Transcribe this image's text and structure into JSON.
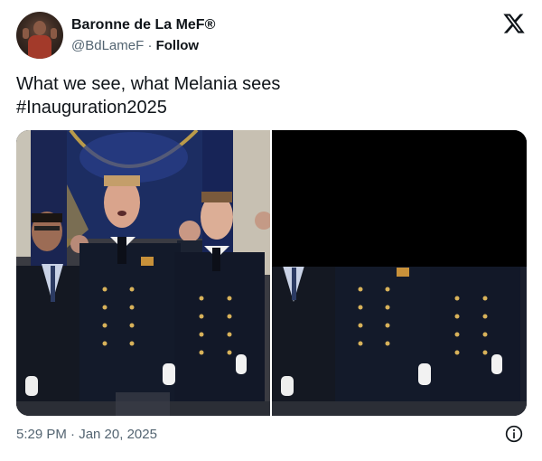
{
  "author": {
    "display_name": "Baronne de La MeF®",
    "handle": "@BdLameF",
    "separator": "·",
    "follow_label": "Follow"
  },
  "tweet": {
    "line1": "What we see, what Melania sees",
    "line2": "#Inauguration2025"
  },
  "timestamp": "5:29 PM · Jan 20, 2025",
  "icons": {
    "logo": "x-logo-icon",
    "info": "info-icon"
  },
  "colors": {
    "text": "#0f1419",
    "secondary": "#536471",
    "uniform": "#131a2a",
    "curtain": "#1c2d62"
  }
}
